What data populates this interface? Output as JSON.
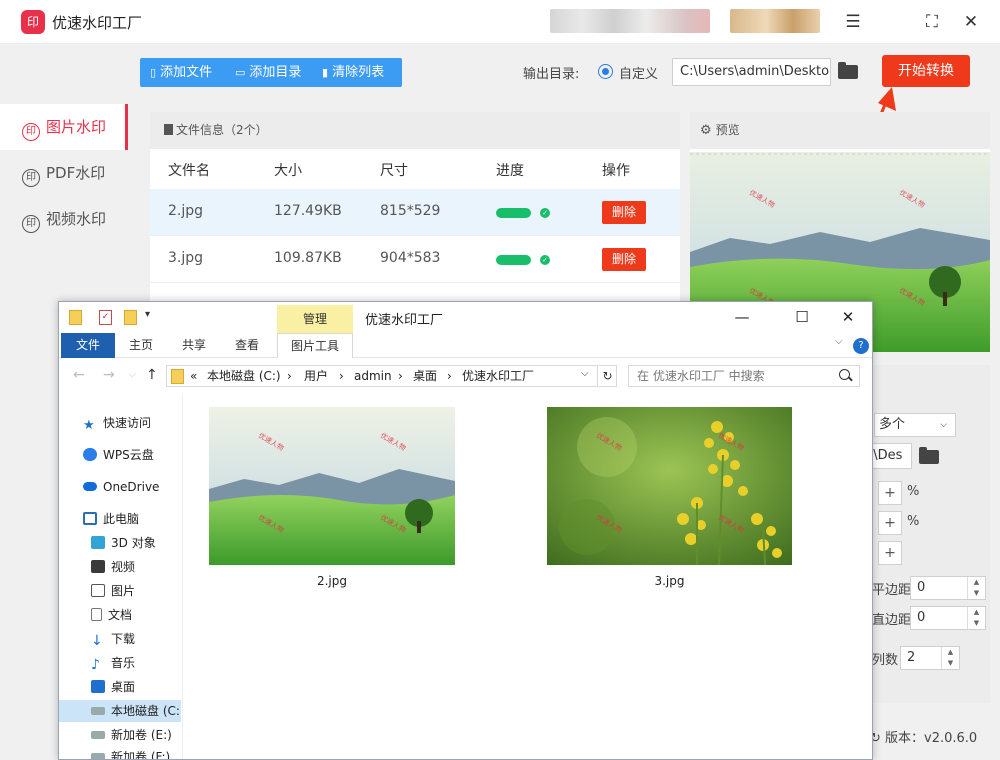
{
  "app": {
    "logo_glyph": "印",
    "title": "优速水印工厂",
    "controls": {
      "menu": "☰",
      "maximize": "⛶",
      "close": "✕"
    }
  },
  "sidebar": {
    "items": [
      {
        "label": "图片水印",
        "active": true
      },
      {
        "label": "PDF水印",
        "active": false
      },
      {
        "label": "视频水印",
        "active": false
      }
    ],
    "icon_glyph": "印"
  },
  "toolbar": {
    "add_file": "添加文件",
    "add_dir": "添加目录",
    "clear_list": "清除列表"
  },
  "output": {
    "label": "输出目录:",
    "option": "自定义",
    "path": "C:\\Users\\admin\\Deskto",
    "start_button": "开始转换"
  },
  "file_panel": {
    "title": "文件信息（2个）",
    "columns": [
      "文件名",
      "大小",
      "尺寸",
      "进度",
      "操作"
    ],
    "rows": [
      {
        "name": "2.jpg",
        "size": "127.49KB",
        "dims": "815*529",
        "progress": 1.0,
        "action": "删除"
      },
      {
        "name": "3.jpg",
        "size": "109.87KB",
        "dims": "904*583",
        "progress": 1.0,
        "action": "删除"
      }
    ]
  },
  "preview": {
    "title": "预览",
    "watermark": "优速人物"
  },
  "right_panel": {
    "select_value": "多个",
    "path_partial": "n\\Des",
    "plus": "+",
    "percent": "%",
    "h_margin_label": "平边距",
    "h_margin_value": "0",
    "v_margin_label": "直边距",
    "v_margin_value": "0",
    "cols_label": "列数",
    "cols_value": "2",
    "version": "版本：v2.0.6.0"
  },
  "explorer": {
    "manage_tab": "管理",
    "title": "优速水印工厂",
    "ribbon": {
      "file": "文件",
      "home": "主页",
      "share": "共享",
      "view": "查看",
      "pic_tools": "图片工具"
    },
    "help": "?",
    "address": {
      "prefix": "«",
      "crumbs": [
        "本地磁盘 (C:)",
        "用户",
        "admin",
        "桌面",
        "优速水印工厂"
      ],
      "sep": "›"
    },
    "search_placeholder": "在 优速水印工厂 中搜索",
    "nav": [
      {
        "label": "快速访问",
        "icon": "star-icon"
      },
      {
        "label": "WPS云盘",
        "icon": "cloud-icon"
      },
      {
        "label": "OneDrive",
        "icon": "onedrive-icon"
      },
      {
        "label": "此电脑",
        "icon": "pc-icon"
      },
      {
        "label": "3D 对象",
        "icon": "cube-icon"
      },
      {
        "label": "视频",
        "icon": "video-icon"
      },
      {
        "label": "图片",
        "icon": "picture-icon"
      },
      {
        "label": "文档",
        "icon": "document-icon"
      },
      {
        "label": "下载",
        "icon": "download-icon"
      },
      {
        "label": "音乐",
        "icon": "music-icon"
      },
      {
        "label": "桌面",
        "icon": "desktop-icon"
      },
      {
        "label": "本地磁盘 (C:",
        "icon": "drive-icon",
        "selected": true
      },
      {
        "label": "新加卷 (E:)",
        "icon": "drive-icon"
      },
      {
        "label": "新加卷 (F:)",
        "icon": "drive-icon"
      }
    ],
    "files": [
      {
        "name": "2.jpg",
        "kind": "landscape"
      },
      {
        "name": "3.jpg",
        "kind": "flowers"
      }
    ],
    "watermark": "优速人物"
  },
  "colors": {
    "accent_red": "#e8304a",
    "start_red": "#ee3a1b",
    "toolbar_blue": "#3c9bf3",
    "progress_green": "#19be6b"
  }
}
